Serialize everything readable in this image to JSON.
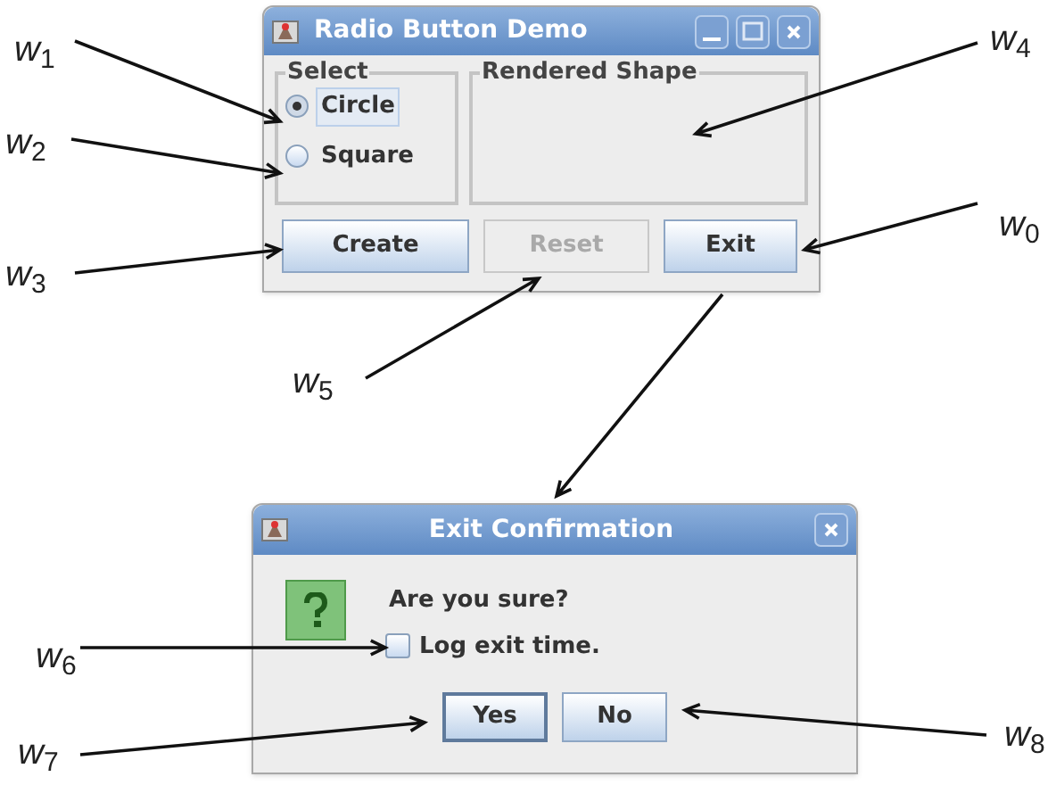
{
  "annotations": [
    {
      "label": "*w*$_{1}$"
    },
    {
      "label": "*w*$_{2}$"
    },
    {
      "label": "*w*$_{3}$"
    },
    {
      "label": "*w*$_{4}$"
    },
    {
      "label": "*w*$_{0}$"
    },
    {
      "label": "*w*$_{5}$"
    },
    {
      "label": "*w*$_{6}$"
    },
    {
      "label": "*w*$_{7}$"
    },
    {
      "label": "*w*$_{8}$"
    }
  ],
  "main_window": {
    "title": "Radio Button Demo",
    "select_group": {
      "title": "Select",
      "options": [
        {
          "label": "Circle",
          "selected": true,
          "focused": true
        },
        {
          "label": "Square",
          "selected": false,
          "focused": false
        }
      ]
    },
    "shape_group": {
      "title": "Rendered Shape"
    },
    "buttons": [
      {
        "label": "Create",
        "disabled": false
      },
      {
        "label": "Reset",
        "disabled": true
      },
      {
        "label": "Exit",
        "disabled": false
      }
    ]
  },
  "dialog": {
    "title": "Exit Confirmation",
    "message": "Are you sure?",
    "checkbox": {
      "label": "Log exit time.",
      "checked": false
    },
    "buttons": [
      {
        "label": "Yes",
        "focused": true
      },
      {
        "label": "No",
        "focused": false
      }
    ]
  }
}
